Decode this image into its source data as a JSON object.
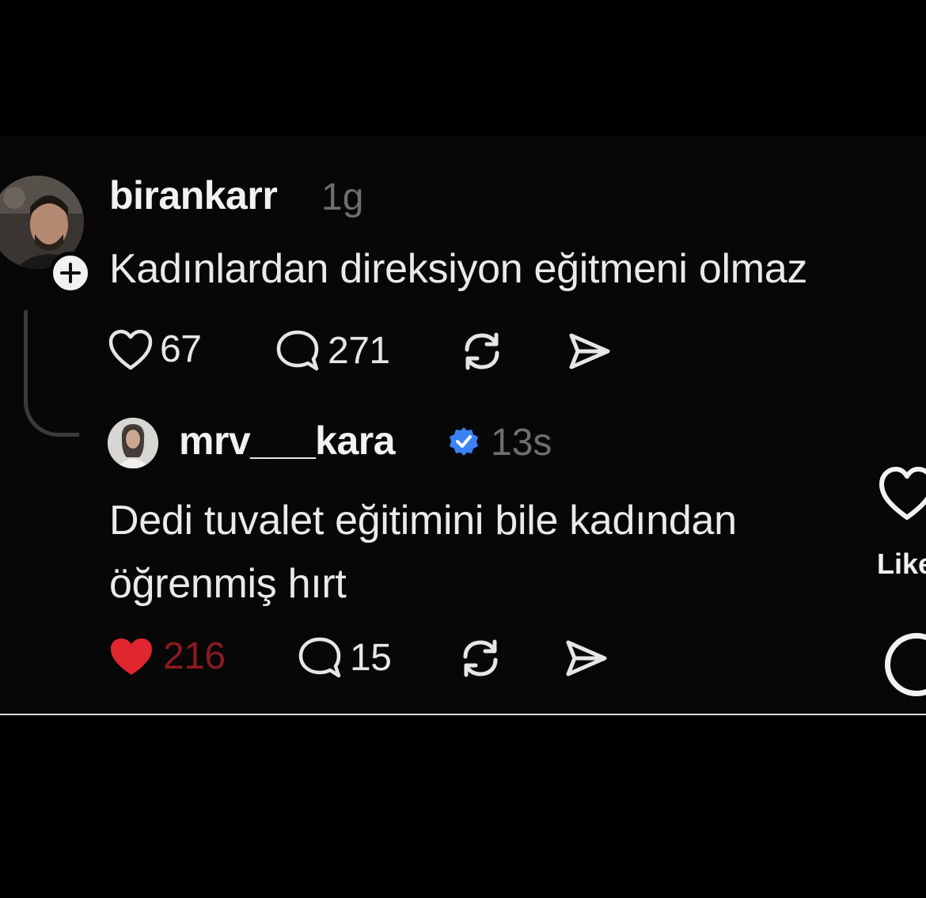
{
  "post": {
    "username": "birankarr",
    "time": "1g",
    "text": "Kadınlardan direksiyon eğitmeni olmaz",
    "likes": "67",
    "comments": "271"
  },
  "reply": {
    "username": "mrv___kara",
    "time": "13s",
    "text": "Dedi tuvalet eğitimini bile kadından öğrenmiş hırt",
    "likes": "216",
    "comments": "15",
    "liked": true
  },
  "side": {
    "like_label": "Like"
  },
  "colors": {
    "background": "#000000",
    "like_red": "#e0262f",
    "verified_blue": "#3b82f6",
    "muted_text": "#6e6e6e"
  }
}
